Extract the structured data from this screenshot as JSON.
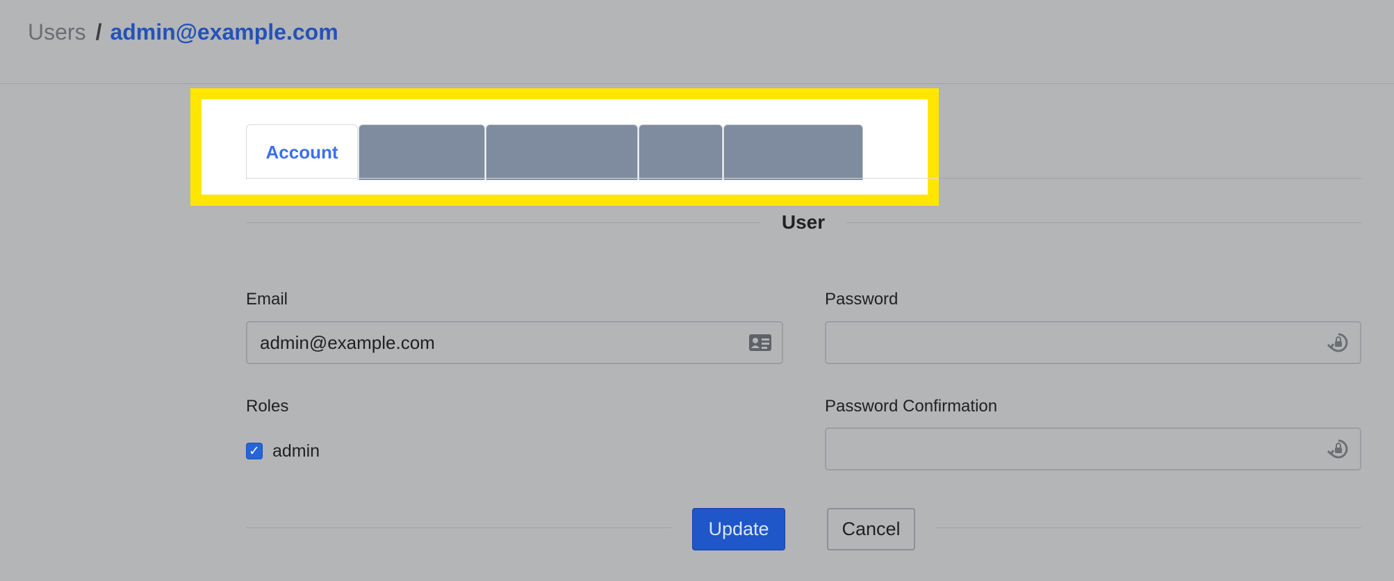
{
  "breadcrumb": {
    "parent": "Users",
    "separator": "/",
    "current": "admin@example.com"
  },
  "tabs": [
    {
      "label": "Account",
      "active": true
    },
    {
      "label": ""
    },
    {
      "label": ""
    },
    {
      "label": ""
    },
    {
      "label": ""
    }
  ],
  "section": {
    "title": "User"
  },
  "form": {
    "email": {
      "label": "Email",
      "value": "admin@example.com",
      "icon": "id-card-icon"
    },
    "password": {
      "label": "Password",
      "value": "",
      "icon": "lock-reset-icon"
    },
    "password_confirmation": {
      "label": "Password Confirmation",
      "value": "",
      "icon": "lock-reset-icon"
    },
    "roles": {
      "label": "Roles",
      "options": [
        {
          "label": "admin",
          "checked": true
        }
      ]
    }
  },
  "actions": {
    "update": "Update",
    "cancel": "Cancel"
  },
  "colors": {
    "accent": "#2352b8",
    "tab_active_text": "#3a6ff0",
    "primary_button": "#1f56c8",
    "highlight": "#ffe600",
    "placeholder_tab": "#7f8c9f"
  }
}
